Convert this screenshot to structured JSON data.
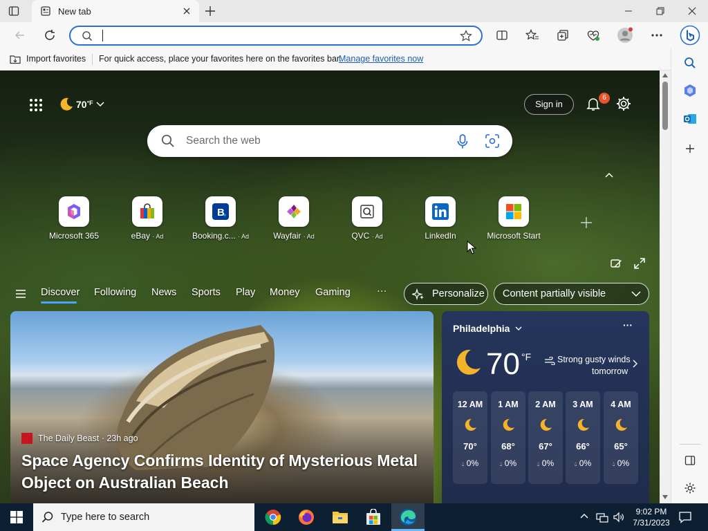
{
  "browser": {
    "tab_title": "New tab",
    "address_value": "",
    "favorites_bar": {
      "import_label": "Import favorites",
      "message": "For quick access, place your favorites here on the favorites bar.",
      "manage_link": "Manage favorites now"
    }
  },
  "page": {
    "header": {
      "weather_temp": "70",
      "weather_unit": "°F",
      "sign_in_label": "Sign in",
      "notification_count": "6"
    },
    "search": {
      "placeholder": "Search the web"
    },
    "quick_links": [
      {
        "label": "Microsoft 365",
        "ad": ""
      },
      {
        "label": "eBay",
        "ad": "· Ad"
      },
      {
        "label": "Booking.c...",
        "ad": "· Ad"
      },
      {
        "label": "Wayfair",
        "ad": "· Ad"
      },
      {
        "label": "QVC",
        "ad": "· Ad"
      },
      {
        "label": "LinkedIn",
        "ad": ""
      },
      {
        "label": "Microsoft Start",
        "ad": ""
      }
    ],
    "nav": {
      "items": [
        "Discover",
        "Following",
        "News",
        "Sports",
        "Play",
        "Money",
        "Gaming"
      ],
      "more_label": "···",
      "personalize_label": "Personalize",
      "visibility_label": "Content partially visible"
    },
    "hero": {
      "source": "The Daily Beast",
      "age": "· 23h ago",
      "title": "Space Agency Confirms Identity of Mysterious Metal Object on Australian Beach"
    },
    "weather": {
      "city": "Philadelphia",
      "temp": "70",
      "unit": "°F",
      "forecast_line1": "Strong gusty winds",
      "forecast_line2": "tomorrow",
      "more_label": "···",
      "hours": [
        {
          "time": "12 AM",
          "temp": "70°",
          "precip": "0%"
        },
        {
          "time": "1 AM",
          "temp": "68°",
          "precip": "0%"
        },
        {
          "time": "2 AM",
          "temp": "67°",
          "precip": "0%"
        },
        {
          "time": "3 AM",
          "temp": "66°",
          "precip": "0%"
        },
        {
          "time": "4 AM",
          "temp": "65°",
          "precip": "0%"
        }
      ]
    }
  },
  "taskbar": {
    "search_placeholder": "Type here to search",
    "time": "9:02 PM",
    "date": "7/31/2023"
  },
  "colors": {
    "edge_accent": "#2b6fd6",
    "link": "#1a5fb4",
    "notification_badge": "#e8542c",
    "taskbar": "#0d1f33",
    "weather_card": "#25355b"
  }
}
